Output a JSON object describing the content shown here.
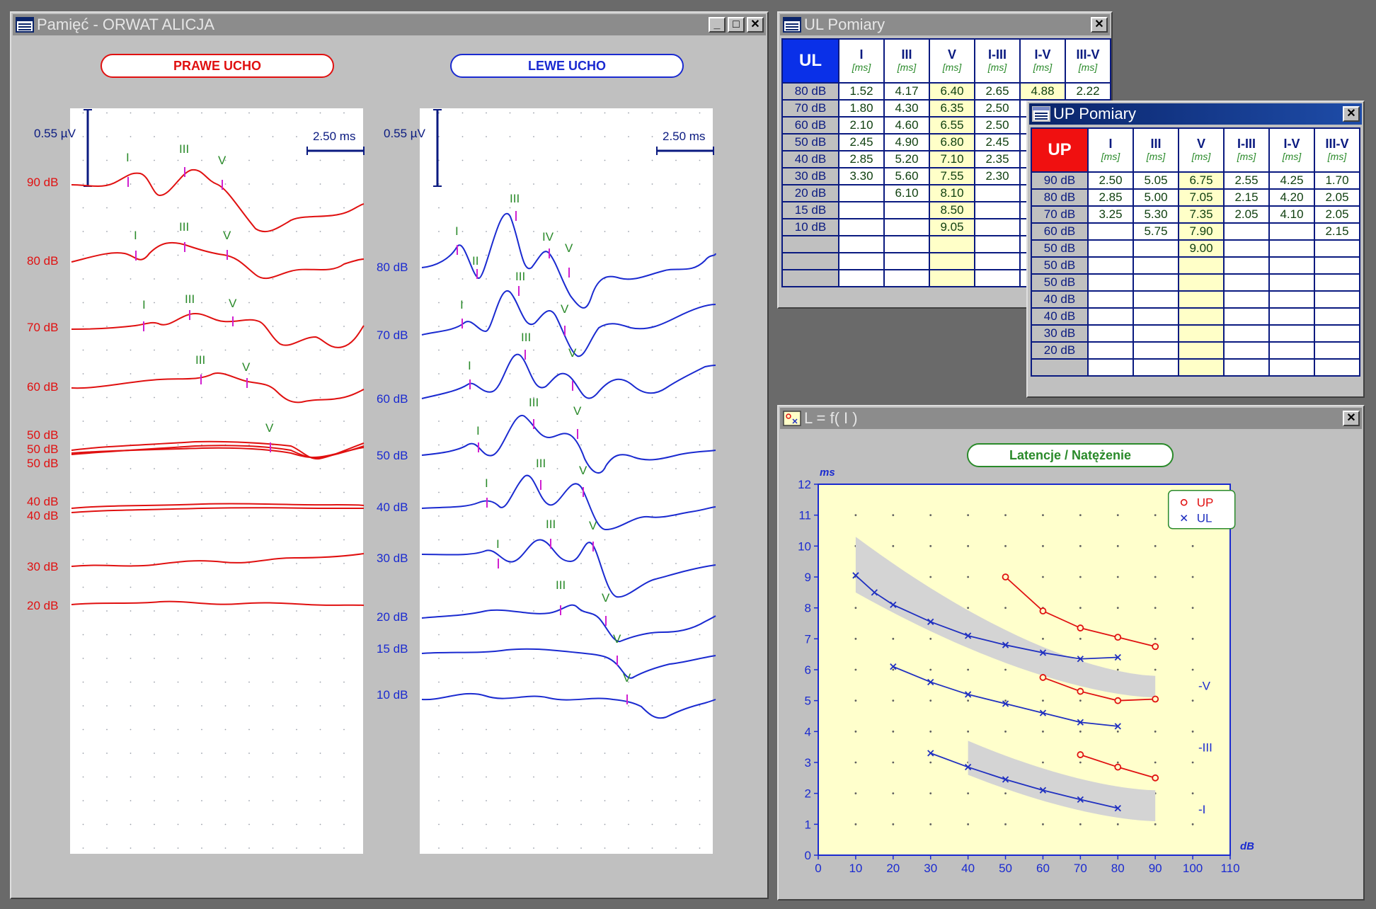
{
  "memory_window": {
    "title": "Pamięć - ORWAT ALICJA",
    "right_ear_label": "PRAWE UCHO",
    "left_ear_label": "LEWE UCHO",
    "amplitude_scale": "0.55 µV",
    "time_scale": "2.50 ms",
    "right_levels": [
      "90 dB",
      "80 dB",
      "70 dB",
      "60 dB",
      "50 dB",
      "50 dB",
      "50 dB",
      "40 dB",
      "40 dB",
      "30 dB",
      "20 dB"
    ],
    "left_levels": [
      "80 dB",
      "70 dB",
      "60 dB",
      "50 dB",
      "40 dB",
      "30 dB",
      "20 dB",
      "15 dB",
      "10 dB"
    ],
    "peak_labels": [
      "I",
      "II",
      "III",
      "IV",
      "V"
    ]
  },
  "ul_window": {
    "title": "UL Pomiary",
    "corner": "UL",
    "columns": [
      "I",
      "III",
      "V",
      "I-III",
      "I-V",
      "III-V"
    ],
    "unit": "[ms]",
    "rows": [
      {
        "level": "80 dB",
        "values": [
          "1.52",
          "4.17",
          "6.40",
          "2.65",
          "4.88",
          "2.22"
        ]
      },
      {
        "level": "70 dB",
        "values": [
          "1.80",
          "4.30",
          "6.35",
          "2.50",
          "",
          ""
        ]
      },
      {
        "level": "60 dB",
        "values": [
          "2.10",
          "4.60",
          "6.55",
          "2.50",
          "",
          ""
        ]
      },
      {
        "level": "50 dB",
        "values": [
          "2.45",
          "4.90",
          "6.80",
          "2.45",
          "",
          ""
        ]
      },
      {
        "level": "40 dB",
        "values": [
          "2.85",
          "5.20",
          "7.10",
          "2.35",
          "",
          ""
        ]
      },
      {
        "level": "30 dB",
        "values": [
          "3.30",
          "5.60",
          "7.55",
          "2.30",
          "",
          ""
        ]
      },
      {
        "level": "20 dB",
        "values": [
          "",
          "6.10",
          "8.10",
          "",
          "",
          ""
        ]
      },
      {
        "level": "15 dB",
        "values": [
          "",
          "",
          "8.50",
          "",
          "",
          ""
        ]
      },
      {
        "level": "10 dB",
        "values": [
          "",
          "",
          "9.05",
          "",
          "",
          ""
        ]
      },
      {
        "level": "",
        "values": [
          "",
          "",
          "",
          "",
          "",
          ""
        ]
      },
      {
        "level": "",
        "values": [
          "",
          "",
          "",
          "",
          "",
          ""
        ]
      },
      {
        "level": "",
        "values": [
          "",
          "",
          "",
          "",
          "",
          ""
        ]
      }
    ]
  },
  "up_window": {
    "title": "UP Pomiary",
    "corner": "UP",
    "columns": [
      "I",
      "III",
      "V",
      "I-III",
      "I-V",
      "III-V"
    ],
    "unit": "[ms]",
    "rows": [
      {
        "level": "90 dB",
        "values": [
          "2.50",
          "5.05",
          "6.75",
          "2.55",
          "4.25",
          "1.70"
        ]
      },
      {
        "level": "80 dB",
        "values": [
          "2.85",
          "5.00",
          "7.05",
          "2.15",
          "4.20",
          "2.05"
        ]
      },
      {
        "level": "70 dB",
        "values": [
          "3.25",
          "5.30",
          "7.35",
          "2.05",
          "4.10",
          "2.05"
        ]
      },
      {
        "level": "60 dB",
        "values": [
          "",
          "5.75",
          "7.90",
          "",
          "",
          "2.15"
        ]
      },
      {
        "level": "50 dB",
        "values": [
          "",
          "",
          "9.00",
          "",
          "",
          ""
        ]
      },
      {
        "level": "50 dB",
        "values": [
          "",
          "",
          "",
          "",
          "",
          ""
        ]
      },
      {
        "level": "50 dB",
        "values": [
          "",
          "",
          "",
          "",
          "",
          ""
        ]
      },
      {
        "level": "40 dB",
        "values": [
          "",
          "",
          "",
          "",
          "",
          ""
        ]
      },
      {
        "level": "40 dB",
        "values": [
          "",
          "",
          "",
          "",
          "",
          ""
        ]
      },
      {
        "level": "30 dB",
        "values": [
          "",
          "",
          "",
          "",
          "",
          ""
        ]
      },
      {
        "level": "20 dB",
        "values": [
          "",
          "",
          "",
          "",
          "",
          ""
        ]
      },
      {
        "level": "",
        "values": [
          "",
          "",
          "",
          "",
          "",
          ""
        ]
      }
    ]
  },
  "chart_window": {
    "title": "L = f( I )",
    "chart_title": "Latencje / Natężenie"
  },
  "chart_data": {
    "type": "line",
    "title": "Latencje / Natężenie",
    "xlabel": "dB",
    "ylabel": "ms",
    "xlim": [
      0,
      110
    ],
    "ylim": [
      0,
      12
    ],
    "xticks": [
      0,
      10,
      20,
      30,
      40,
      50,
      60,
      70,
      80,
      90,
      100,
      110
    ],
    "yticks": [
      0,
      1,
      2,
      3,
      4,
      5,
      6,
      7,
      8,
      9,
      10,
      11,
      12
    ],
    "grid": "dotted",
    "legend_position": "top-right",
    "wave_labels": [
      "-V",
      "-III",
      "-I"
    ],
    "series": [
      {
        "name": "UP",
        "marker": "circle",
        "color": "#e01010",
        "wave": "V",
        "x": [
          50,
          60,
          70,
          80,
          90
        ],
        "y": [
          9.0,
          7.9,
          7.35,
          7.05,
          6.75
        ]
      },
      {
        "name": "UP",
        "marker": "circle",
        "color": "#e01010",
        "wave": "III",
        "x": [
          60,
          70,
          80,
          90
        ],
        "y": [
          5.75,
          5.3,
          5.0,
          5.05
        ]
      },
      {
        "name": "UP",
        "marker": "circle",
        "color": "#e01010",
        "wave": "I",
        "x": [
          70,
          80,
          90
        ],
        "y": [
          3.25,
          2.85,
          2.5
        ]
      },
      {
        "name": "UL",
        "marker": "cross",
        "color": "#2030c0",
        "wave": "V",
        "x": [
          10,
          15,
          20,
          30,
          40,
          50,
          60,
          70,
          80
        ],
        "y": [
          9.05,
          8.5,
          8.1,
          7.55,
          7.1,
          6.8,
          6.55,
          6.35,
          6.4
        ]
      },
      {
        "name": "UL",
        "marker": "cross",
        "color": "#2030c0",
        "wave": "III",
        "x": [
          20,
          30,
          40,
          50,
          60,
          70,
          80
        ],
        "y": [
          6.1,
          5.6,
          5.2,
          4.9,
          4.6,
          4.3,
          4.17
        ]
      },
      {
        "name": "UL",
        "marker": "cross",
        "color": "#2030c0",
        "wave": "I",
        "x": [
          30,
          40,
          50,
          60,
          70,
          80
        ],
        "y": [
          3.3,
          2.85,
          2.45,
          2.1,
          1.8,
          1.52
        ]
      }
    ],
    "norm_bands": [
      {
        "wave": "V",
        "x": [
          10,
          90
        ],
        "upper": [
          10.3,
          5.8
        ],
        "lower": [
          8.5,
          5.1
        ]
      },
      {
        "wave": "I",
        "x": [
          40,
          90
        ],
        "upper": [
          3.7,
          2.1
        ],
        "lower": [
          2.6,
          1.1
        ]
      }
    ],
    "legend": [
      {
        "label": "UP",
        "marker": "circle",
        "color": "#e01010"
      },
      {
        "label": "UL",
        "marker": "cross",
        "color": "#2030c0"
      }
    ]
  }
}
